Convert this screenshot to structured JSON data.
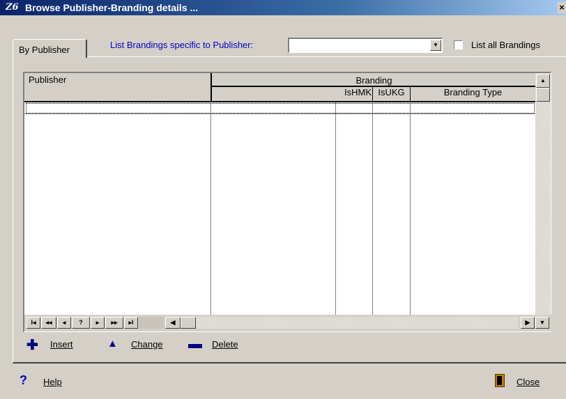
{
  "window": {
    "title": "Browse Publisher-Branding details ...",
    "app_glyph": "Z6",
    "close_glyph": "×"
  },
  "tabs": [
    {
      "label": "By Publisher",
      "active": true
    }
  ],
  "filter": {
    "label": "List Brandings specific to Publisher:",
    "publisher_value": "",
    "list_all_label": "List all Brandings",
    "list_all_checked": false
  },
  "grid": {
    "columns": {
      "publisher": "Publisher",
      "branding_group": "Branding",
      "ishmk": "IsHMK",
      "isukg": "IsUKG",
      "branding_type": "Branding Type"
    },
    "rows": []
  },
  "navigator": {
    "first": "I◂",
    "prev_page": "◂◂",
    "prev": "◂",
    "find": "?",
    "next": "▸",
    "next_page": "▸▸",
    "last": "▸I"
  },
  "actions": {
    "insert_label": "Insert",
    "change_label": "Change",
    "delete_label": "Delete"
  },
  "footer": {
    "help_label": "Help",
    "close_label": "Close"
  },
  "colors": {
    "title_bar": "#0a246a",
    "window_bg": "#d4d0c8",
    "filter_label": "#0000c0",
    "action_icon": "#000080"
  },
  "icons": [
    "plus-icon",
    "triangle-icon",
    "minus-icon",
    "question-icon",
    "door-exit-icon"
  ]
}
